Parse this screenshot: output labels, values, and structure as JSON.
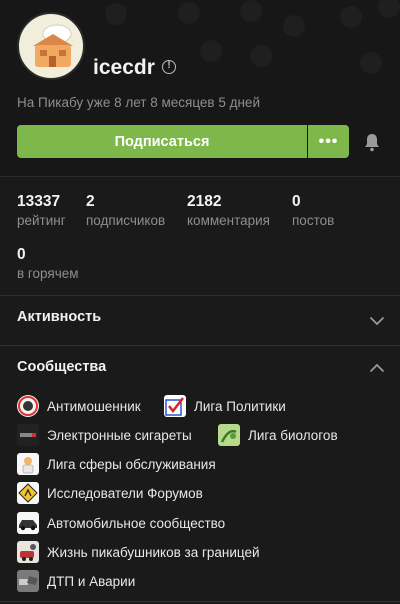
{
  "profile": {
    "username": "icecdr",
    "on_pikabu": "На Пикабу уже 8 лет 8 месяцев 5 дней"
  },
  "actions": {
    "subscribe_label": "Подписаться",
    "more_label": "•••"
  },
  "stats": [
    {
      "value": "13337",
      "label": "рейтинг"
    },
    {
      "value": "2",
      "label": "подписчиков"
    },
    {
      "value": "2182",
      "label": "комментария"
    },
    {
      "value": "0",
      "label": "постов"
    },
    {
      "value": "0",
      "label": "в горячем"
    }
  ],
  "sections": {
    "activity_title": "Активность",
    "communities_title": "Сообщества"
  },
  "communities": [
    {
      "label": "Антимошенник",
      "icon": "antifraud-icon"
    },
    {
      "label": "Лига Политики",
      "icon": "checkmark-icon"
    },
    {
      "label": "Электронные сигареты",
      "icon": "vape-icon"
    },
    {
      "label": "Лига биологов",
      "icon": "biology-icon"
    },
    {
      "label": "Лига сферы обслуживания",
      "icon": "service-icon"
    },
    {
      "label": "Исследователи Форумов",
      "icon": "warning-sign-icon"
    },
    {
      "label": "Автомобильное сообщество",
      "icon": "car-icon"
    },
    {
      "label": "Жизнь пикабушников за границей",
      "icon": "abroad-icon"
    },
    {
      "label": "ДТП и Аварии",
      "icon": "accident-icon"
    }
  ],
  "colors": {
    "accent_green": "#7eb84a",
    "background": "#1a1a1a",
    "muted_text": "#8e8e8e"
  }
}
